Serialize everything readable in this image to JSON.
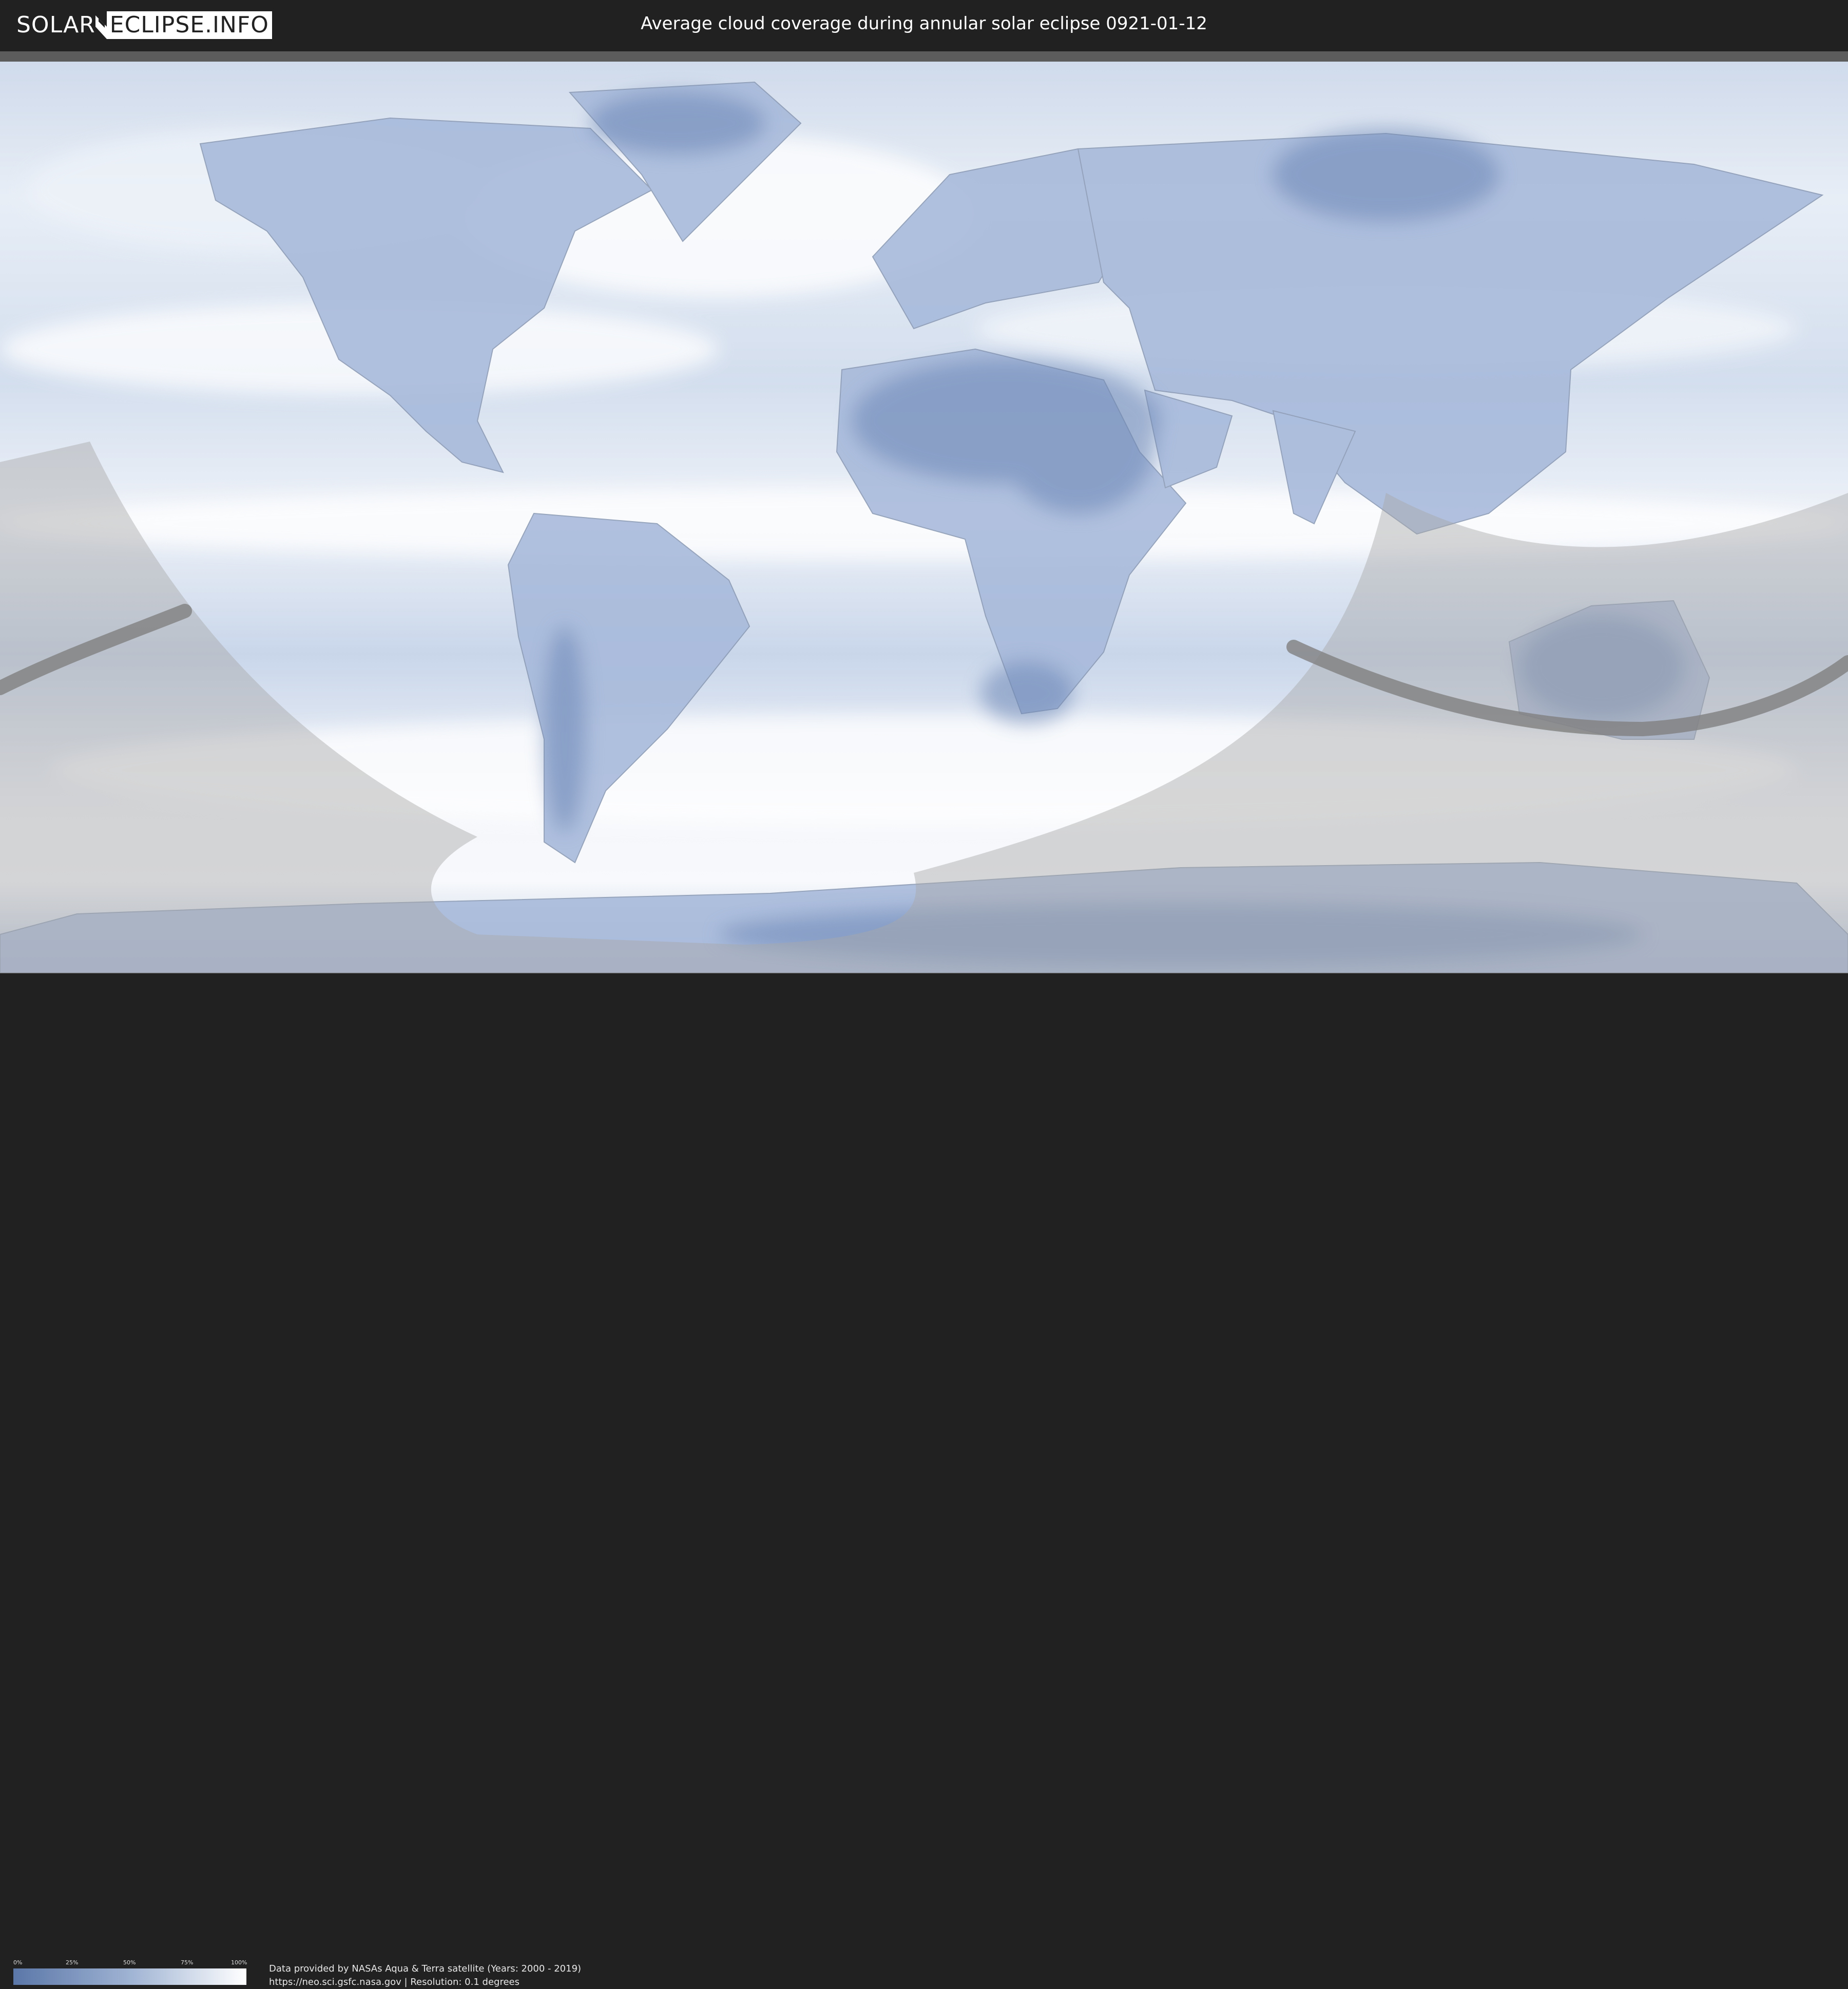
{
  "header": {
    "logo_left": "SOLAR",
    "logo_right": "ECLIPSE.INFO",
    "title": "Average cloud coverage during annular solar eclipse 0921-01-12"
  },
  "map": {
    "ocean_cloud_color": "#dfe7f2",
    "land_clear_color": "#5b77a8",
    "cloud_color": "#ffffff",
    "shadow_color": "#9a9a9a",
    "path_color": "#7f7f7f"
  },
  "legend": {
    "ticks": [
      "0%",
      "25%",
      "50%",
      "75%",
      "100%"
    ],
    "gradient": [
      "#5b77a8",
      "#9fb3d3",
      "#ffffff"
    ]
  },
  "footer": {
    "credit_line1": "Data provided by NASAs Aqua & Terra satellite (Years: 2000 - 2019)",
    "credit_line2": "https://neo.sci.gsfc.nasa.gov | Resolution: 0.1 degrees"
  }
}
